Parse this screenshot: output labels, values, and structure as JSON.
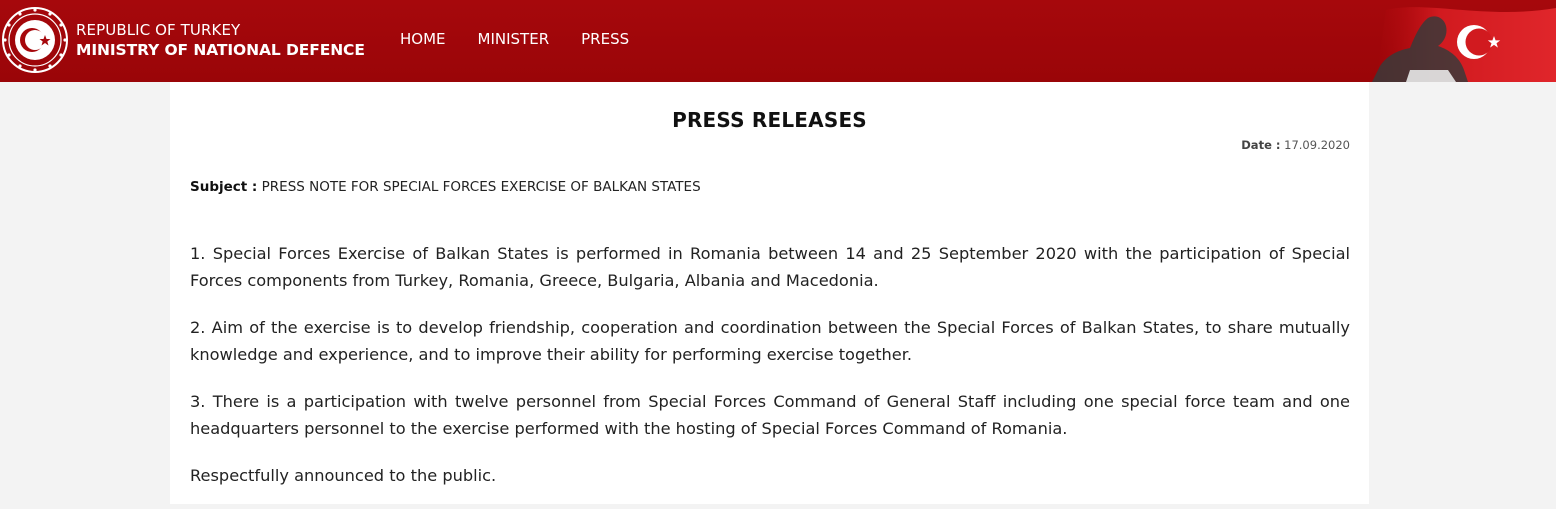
{
  "header": {
    "brand_line1": "REPUBLIC OF TURKEY",
    "brand_line2": "MINISTRY OF NATIONAL DEFENCE",
    "nav": [
      "HOME",
      "MINISTER",
      "PRESS"
    ],
    "colors": {
      "header_bg": "#a6080c",
      "text": "#ffffff"
    },
    "icons": {
      "emblem": "ministry-emblem-icon",
      "flag": "flag-banner-image"
    }
  },
  "page": {
    "title": "PRESS RELEASES",
    "date_label": "Date :",
    "date_value": "17.09.2020",
    "subject_label": "Subject :",
    "subject_value": "PRESS NOTE FOR SPECIAL FORCES EXERCISE OF BALKAN STATES",
    "paragraphs": [
      "1. Special Forces Exercise of Balkan States is performed in Romania between 14 and 25 September 2020 with the participation of Special Forces components from Turkey, Romania, Greece, Bulgaria, Albania and Macedonia.",
      "2. Aim of the exercise is to develop friendship, cooperation and coordination between the Special Forces of Balkan States, to share mutually knowledge and experience, and to improve their ability for performing exercise together.",
      "3. There is a participation with twelve personnel from Special Forces Command of General Staff including one special force team and one headquarters personnel to the exercise performed with the hosting of Special Forces Command of Romania.",
      "Respectfully announced to the public."
    ]
  }
}
